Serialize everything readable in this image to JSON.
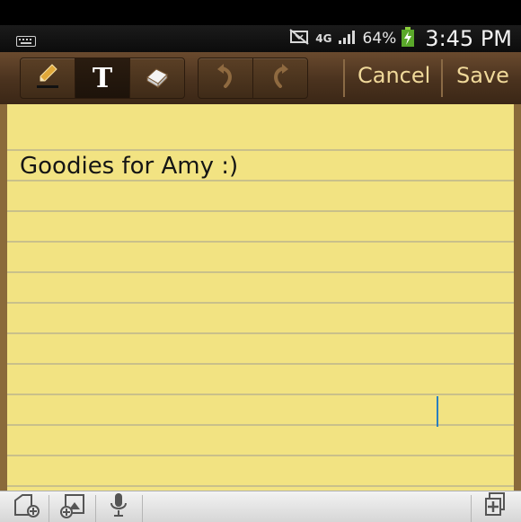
{
  "status_bar": {
    "network": "4G",
    "battery_percent": "64%",
    "time": "3:45 PM"
  },
  "toolbar": {
    "tools": [
      {
        "name": "pen-tool",
        "icon": "pencil-icon"
      },
      {
        "name": "text-tool",
        "label": "T",
        "active": true
      },
      {
        "name": "eraser-tool",
        "icon": "eraser-icon"
      }
    ],
    "history": [
      {
        "name": "undo",
        "icon": "undo-icon"
      },
      {
        "name": "redo",
        "icon": "redo-icon"
      }
    ],
    "cancel_label": "Cancel",
    "save_label": "Save"
  },
  "note": {
    "text": "Goodies for Amy :)"
  },
  "colors": {
    "paper": "#f2e382",
    "rule_line": "#c9c08a",
    "toolbar": "#4a321e",
    "action_text": "#f0d99a",
    "cursor": "#2a7fc0"
  },
  "bottom_bar": {
    "buttons": [
      "insert-image-icon",
      "add-image-icon",
      "microphone-icon",
      "add-page-icon"
    ]
  }
}
